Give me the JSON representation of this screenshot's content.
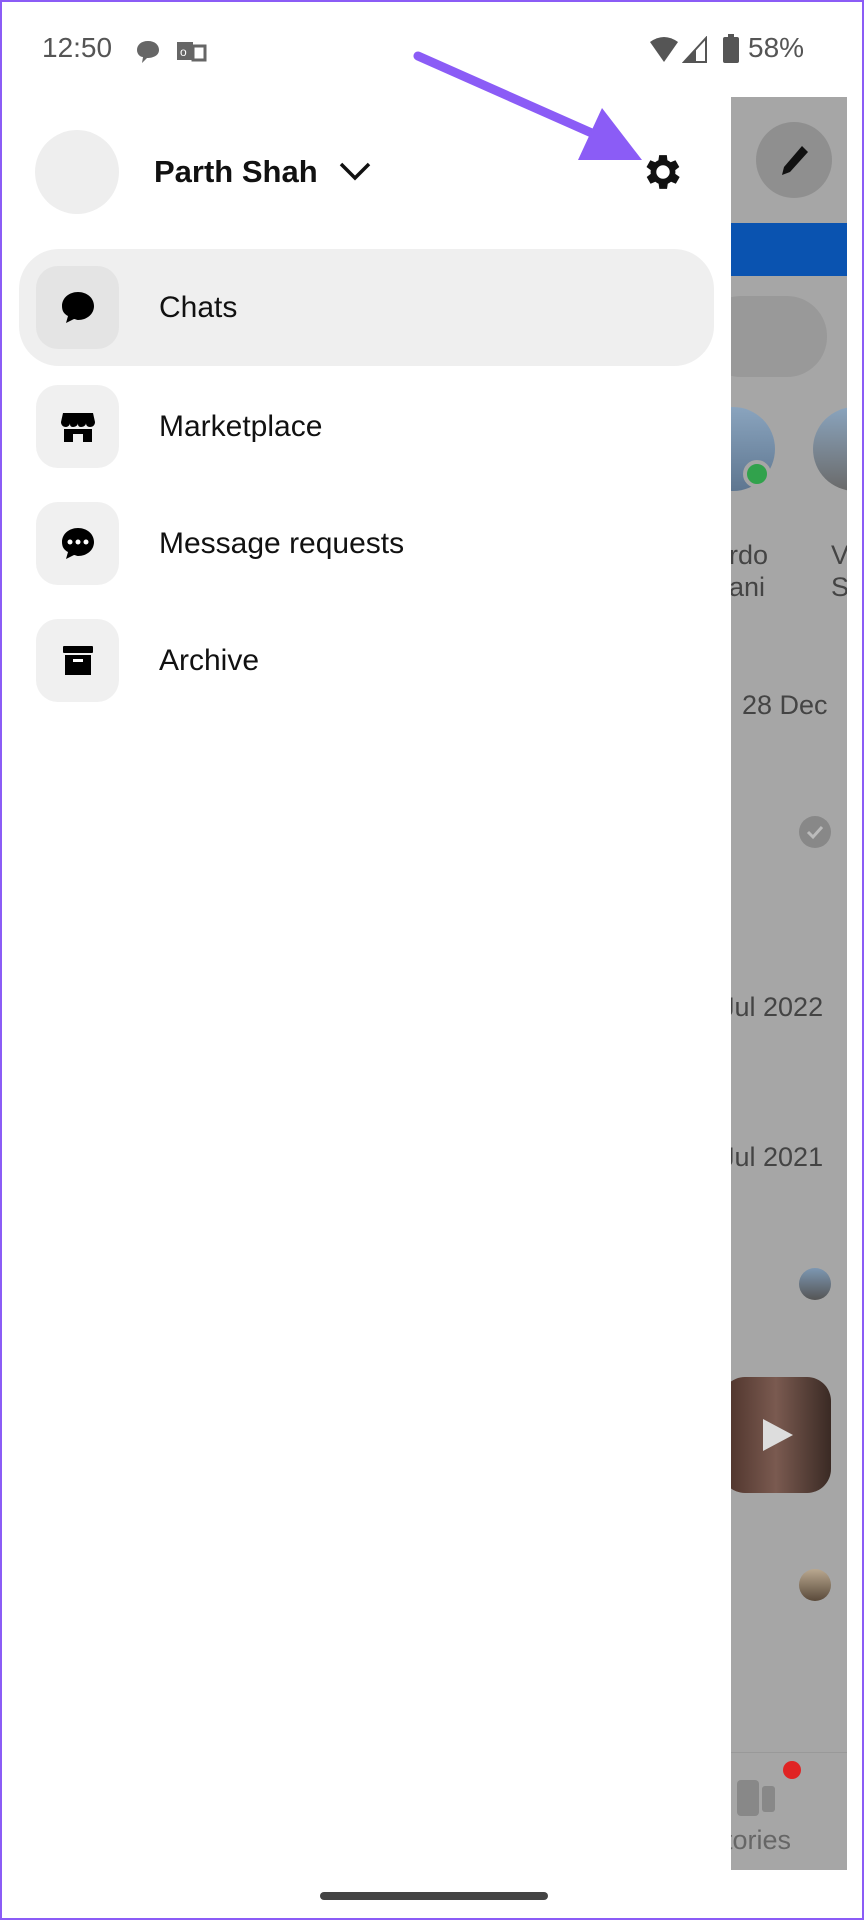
{
  "status_bar": {
    "time": "12:50",
    "battery": "58%",
    "icons": [
      "chat-bubble-icon",
      "outlook-icon",
      "wifi-icon",
      "signal-icon",
      "battery-icon"
    ]
  },
  "profile": {
    "name": "Parth Shah"
  },
  "menu": [
    {
      "label": "Chats",
      "icon": "chat-bubble-icon",
      "active": true
    },
    {
      "label": "Marketplace",
      "icon": "store-icon",
      "active": false
    },
    {
      "label": "Message requests",
      "icon": "message-dots-icon",
      "active": false
    },
    {
      "label": "Archive",
      "icon": "archive-box-icon",
      "active": false
    }
  ],
  "background": {
    "story_names": [
      [
        "rdo",
        "ani"
      ],
      [
        "V",
        "Sh"
      ]
    ],
    "dates": [
      "28 Dec",
      "Jul 2022",
      "Jul 2021"
    ],
    "nav_label": "tories"
  },
  "colors": {
    "annotation_arrow": "#8b5cf6",
    "blue_banner": "#0a53b0",
    "online": "#31a24c",
    "badge": "#e02424"
  }
}
